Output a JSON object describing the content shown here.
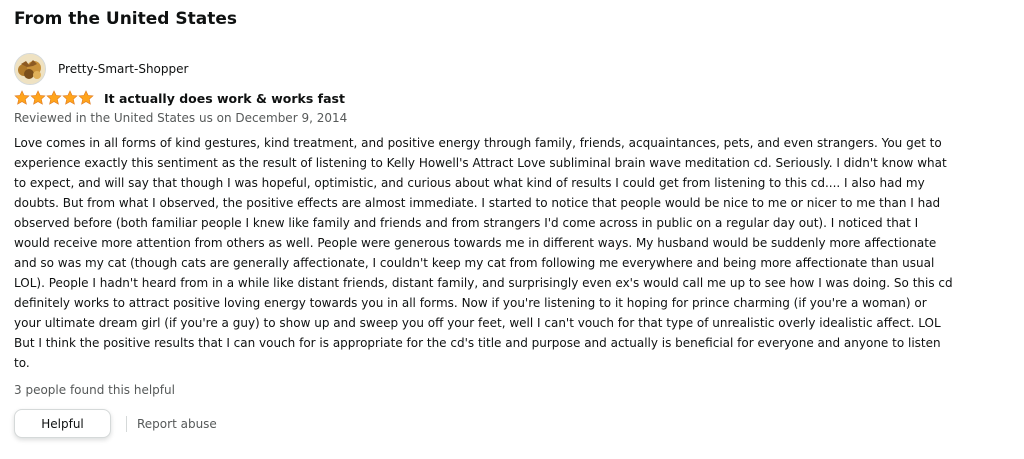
{
  "section": {
    "title": "From the United States"
  },
  "review": {
    "profile": {
      "name": "Pretty-Smart-Shopper",
      "avatar_icon": "profile-avatar-icon"
    },
    "rating": {
      "value": 5,
      "max": 5,
      "star_color": "#ffa41c",
      "star_icon": "star-icon"
    },
    "title": "It actually does work & works fast",
    "date_line": "Reviewed in the United States us on December 9, 2014",
    "body": "Love comes in all forms of kind gestures, kind treatment, and positive energy through family, friends, acquaintances, pets, and even strangers. You get to experience exactly this sentiment as the result of listening to Kelly Howell's Attract Love subliminal brain wave meditation cd. Seriously. I didn't know what to expect, and will say that though I was hopeful, optimistic, and curious about what kind of results I could get from listening to this cd.... I also had my doubts. But from what I observed, the positive effects are almost immediate. I started to notice that people would be nice to me or nicer to me than I had observed before (both familiar people I knew like family and friends and from strangers I'd come across in public on a regular day out). I noticed that I would receive more attention from others as well. People were generous towards me in different ways. My husband would be suddenly more affectionate and so was my cat (though cats are generally affectionate, I couldn't keep my cat from following me everywhere and being more affectionate than usual LOL). People I hadn't heard from in a while like distant friends, distant family, and surprisingly even ex's would call me up to see how I was doing. So this cd definitely works to attract positive loving energy towards you in all forms. Now if you're listening to it hoping for prince charming (if you're a woman) or your ultimate dream girl (if you're a guy) to show up and sweep you off your feet, well I can't vouch for that type of unrealistic overly idealistic affect. LOL But I think the positive results that I can vouch for is appropriate for the cd's title and purpose and actually is beneficial for everyone and anyone to listen to.",
    "helpful_count_text": "3 people found this helpful",
    "actions": {
      "helpful_label": "Helpful",
      "report_label": "Report abuse"
    }
  },
  "colors": {
    "text": "#0f1111",
    "secondary_text": "#565959",
    "border": "#d5d9d9",
    "star": "#ffa41c"
  }
}
